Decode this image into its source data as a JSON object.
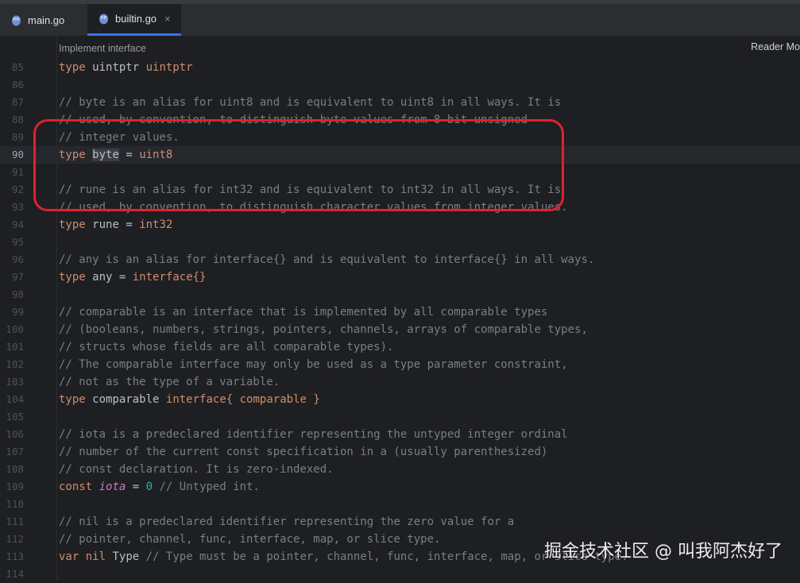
{
  "tabs": [
    {
      "label": "main.go",
      "active": false
    },
    {
      "label": "builtin.go",
      "active": true,
      "close": "×"
    }
  ],
  "hint": "Implement interface",
  "reader_mode": "Reader Mo",
  "lines": {
    "l85": {
      "num": "85"
    },
    "l86": {
      "num": "86"
    },
    "l87": {
      "num": "87",
      "text": "// byte is an alias for uint8 and is equivalent to uint8 in all ways. It is"
    },
    "l88": {
      "num": "88",
      "text": "// used, by convention, to distinguish byte values from 8-bit unsigned"
    },
    "l89": {
      "num": "89",
      "text": "// integer values."
    },
    "l90": {
      "num": "90"
    },
    "l91": {
      "num": "91"
    },
    "l92": {
      "num": "92",
      "text": "// rune is an alias for int32 and is equivalent to int32 in all ways. It is"
    },
    "l93": {
      "num": "93",
      "text": "// used, by convention, to distinguish character values from integer values."
    },
    "l94": {
      "num": "94"
    },
    "l95": {
      "num": "95"
    },
    "l96": {
      "num": "96",
      "text": "// any is an alias for interface{} and is equivalent to interface{} in all ways."
    },
    "l97": {
      "num": "97"
    },
    "l98": {
      "num": "98"
    },
    "l99": {
      "num": "99",
      "text": "// comparable is an interface that is implemented by all comparable types"
    },
    "l100": {
      "num": "100",
      "text": "// (booleans, numbers, strings, pointers, channels, arrays of comparable types,"
    },
    "l101": {
      "num": "101",
      "text": "// structs whose fields are all comparable types)."
    },
    "l102": {
      "num": "102",
      "text": "// The comparable interface may only be used as a type parameter constraint,"
    },
    "l103": {
      "num": "103",
      "text": "// not as the type of a variable."
    },
    "l104": {
      "num": "104"
    },
    "l105": {
      "num": "105"
    },
    "l106": {
      "num": "106",
      "text": "// iota is a predeclared identifier representing the untyped integer ordinal"
    },
    "l107": {
      "num": "107",
      "text": "// number of the current const specification in a (usually parenthesized)"
    },
    "l108": {
      "num": "108",
      "text": "// const declaration. It is zero-indexed."
    },
    "l109": {
      "num": "109"
    },
    "l110": {
      "num": "110"
    },
    "l111": {
      "num": "111",
      "text": "// nil is a predeclared identifier representing the zero value for a"
    },
    "l112": {
      "num": "112",
      "text": "// pointer, channel, func, interface, map, or slice type."
    },
    "l113": {
      "num": "113"
    },
    "l114": {
      "num": "114"
    }
  },
  "tokens": {
    "type": "type",
    "const": "const",
    "var": "var",
    "uintptr_name": "uintptr",
    "uintptr_type": "uintptr",
    "byte": "byte",
    "uint8": "uint8",
    "rune": "rune",
    "int32": "int32",
    "any": "any",
    "interface_braces": "interface{}",
    "comparable": "comparable",
    "interface_open": "interface{",
    "comparable_kw": "comparable",
    "close_brace": "}",
    "iota": "iota",
    "zero": "0",
    "untyped_comment": "// Untyped int.",
    "nil": "nil",
    "Type": "Type",
    "type_comment": "// Type must be a pointer, channel, func, interface, map, or slice type.",
    "eq": "="
  },
  "watermark": "掘金技术社区 @ 叫我阿杰好了"
}
